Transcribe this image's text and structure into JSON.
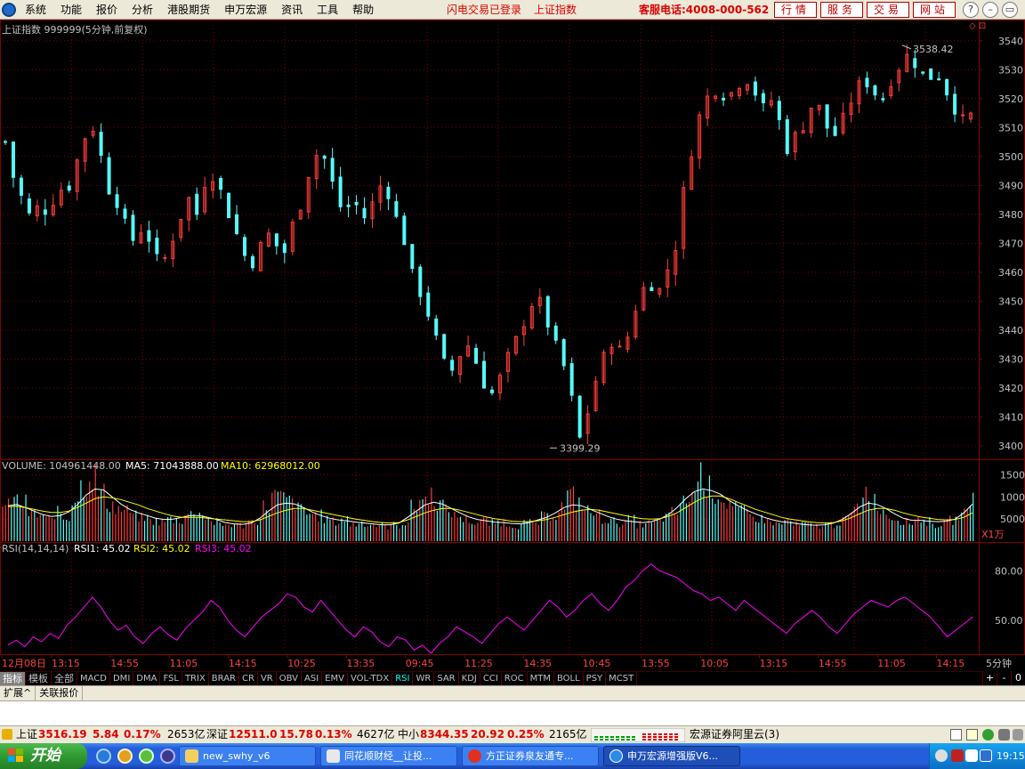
{
  "menubar": {
    "items": [
      "系统",
      "功能",
      "报价",
      "分析",
      "港股期货",
      "申万宏源",
      "资讯",
      "工具",
      "帮助"
    ],
    "status_login": "闪电交易已登录",
    "status_index": "上证指数",
    "hotline": "客服电话:4008-000-562",
    "links": [
      "行情",
      "服务",
      "交易",
      "网站"
    ],
    "window_buttons": [
      "?",
      "–",
      "▭",
      "✕"
    ]
  },
  "chart_header": {
    "title": "上证指数 999999(5分钟,前复权)"
  },
  "volume_header": {
    "volume": "VOLUME: 104961448.00",
    "ma5": "MA5: 71043888.00",
    "ma10": "MA10: 62968012.00",
    "unit": "X1万"
  },
  "rsi_header": {
    "label": "RSI(14,14,14)",
    "rsi1": "RSI1: 45.02",
    "rsi2": "RSI2: 45.02",
    "rsi3": "RSI3: 45.02"
  },
  "chart_data": [
    {
      "type": "candlestick",
      "title": "上证指数 999999(5分钟,前复权)",
      "ylim": [
        3396,
        3543
      ],
      "y_ticks": [
        3400,
        3410,
        3420,
        3430,
        3440,
        3450,
        3460,
        3470,
        3480,
        3490,
        3500,
        3510,
        3520,
        3530,
        3540
      ],
      "annotations": [
        {
          "label": "3538.42",
          "value": 3538.42,
          "type": "high"
        },
        {
          "label": "3399.29",
          "value": 3399.29,
          "type": "low"
        }
      ],
      "close_path": [
        3505,
        3492,
        3485,
        3478,
        3484,
        3480,
        3490,
        3487,
        3496,
        3506,
        3511,
        3500,
        3488,
        3484,
        3474,
        3470,
        3478,
        3466,
        3462,
        3470,
        3478,
        3486,
        3480,
        3492,
        3494,
        3486,
        3478,
        3470,
        3462,
        3466,
        3474,
        3470,
        3466,
        3476,
        3484,
        3496,
        3502,
        3498,
        3486,
        3480,
        3486,
        3478,
        3482,
        3490,
        3488,
        3478,
        3470,
        3456,
        3452,
        3442,
        3432,
        3424,
        3430,
        3436,
        3430,
        3422,
        3418,
        3424,
        3432,
        3438,
        3446,
        3452,
        3446,
        3436,
        3430,
        3418,
        3402,
        3412,
        3424,
        3432,
        3438,
        3430,
        3444,
        3452,
        3458,
        3452,
        3460,
        3468,
        3488,
        3504,
        3516,
        3522,
        3524,
        3520,
        3524,
        3528,
        3524,
        3516,
        3520,
        3512,
        3502,
        3508,
        3512,
        3520,
        3514,
        3506,
        3510,
        3518,
        3524,
        3526,
        3522,
        3520,
        3528,
        3532,
        3536,
        3530,
        3526,
        3530,
        3524,
        3518,
        3512,
        3514
      ],
      "bar_count": 122
    },
    {
      "type": "bar",
      "title": "VOLUME",
      "ylim": [
        0,
        16500
      ],
      "y_ticks": [
        5000,
        10000,
        15000
      ],
      "series": [
        {
          "name": "VOLUME",
          "values": [
            7800,
            9200,
            8600,
            6200,
            5800,
            4800,
            6400,
            5200,
            9800,
            12600,
            14800,
            10800,
            8400,
            7200,
            6800,
            5600,
            5200,
            4600,
            4400,
            5000,
            4800,
            6000,
            6800,
            5600,
            4200,
            3600,
            3800,
            3600,
            4400,
            4800,
            7800,
            10200,
            9600,
            8800,
            7200,
            6200,
            5800,
            5000,
            4400,
            5000,
            3800,
            4200,
            3800,
            3600,
            3400,
            3600,
            4200,
            7600,
            9400,
            10400,
            8400,
            6800,
            5600,
            5000,
            4200,
            4600,
            4000,
            4400,
            3800,
            3600,
            4000,
            4200,
            5400,
            6000,
            7800,
            10200,
            8800,
            6800,
            6000,
            5000,
            4400,
            4200,
            4800,
            3800,
            4000,
            4400,
            5400,
            6400,
            8600,
            10600,
            15200,
            12000,
            10400,
            8600,
            7200,
            6600,
            5600,
            5000,
            4400,
            3800,
            4600,
            3600,
            3800,
            3400,
            3600,
            3800,
            4400,
            5400,
            7600,
            11200,
            9000,
            6800,
            5600,
            4800,
            4200,
            5200,
            4400,
            3800,
            4000,
            4800,
            6000,
            9600
          ]
        },
        {
          "name": "MA5",
          "values": [
            8000,
            8300,
            7600,
            6800,
            6000,
            5600,
            5800,
            6600,
            8200,
            10400,
            11800,
            11600,
            10000,
            8400,
            7200,
            6400,
            5800,
            5200,
            4900,
            5000,
            5400,
            5800,
            5800,
            5400,
            4900,
            4200,
            3900,
            3800,
            4100,
            5200,
            6800,
            8200,
            8600,
            8400,
            7600,
            6600,
            5800,
            5200,
            4800,
            4600,
            4300,
            4100,
            3900,
            3700,
            3700,
            4100,
            5400,
            6800,
            8200,
            8800,
            8400,
            7400,
            6400,
            5500,
            4900,
            4600,
            4300,
            4200,
            4000,
            3900,
            4200,
            4800,
            5400,
            6400,
            7600,
            8200,
            8000,
            7200,
            6400,
            5600,
            5000,
            4600,
            4400,
            4200,
            4400,
            5000,
            6000,
            7600,
            9600,
            11200,
            11800,
            11400,
            10600,
            9200,
            8000,
            7000,
            6200,
            5400,
            4800,
            4400,
            4200,
            3900,
            3700,
            3600,
            3700,
            4100,
            4900,
            6200,
            7700,
            8600,
            8300,
            7400,
            6200,
            5200,
            4700,
            4700,
            4500,
            4400,
            4500,
            5000,
            6400,
            8400
          ]
        },
        {
          "name": "MA10",
          "values": [
            7800,
            7900,
            7600,
            7200,
            6800,
            6500,
            6500,
            6800,
            7600,
            8600,
            9600,
            10000,
            9800,
            9400,
            8800,
            8200,
            7400,
            6800,
            6200,
            5700,
            5400,
            5400,
            5400,
            5200,
            5000,
            4800,
            4600,
            4400,
            4400,
            4800,
            5600,
            6400,
            7000,
            7400,
            7400,
            7000,
            6600,
            6200,
            5800,
            5400,
            5000,
            4700,
            4400,
            4200,
            4100,
            4200,
            4800,
            5600,
            6400,
            7000,
            7400,
            7400,
            7000,
            6500,
            6000,
            5500,
            5100,
            4800,
            4500,
            4400,
            4400,
            4600,
            4900,
            5400,
            6000,
            6600,
            7000,
            7200,
            7000,
            6600,
            6200,
            5800,
            5400,
            5100,
            5000,
            5100,
            5600,
            6400,
            7600,
            8800,
            9800,
            10200,
            10200,
            9600,
            8800,
            8000,
            7200,
            6600,
            6000,
            5400,
            5000,
            4700,
            4400,
            4200,
            4100,
            4200,
            4600,
            5300,
            6200,
            7000,
            7400,
            7400,
            7000,
            6400,
            5900,
            5500,
            5200,
            4900,
            4800,
            4900,
            5400,
            6400
          ]
        }
      ]
    },
    {
      "type": "line",
      "title": "RSI(14,14,14)",
      "ylim": [
        30,
        92
      ],
      "y_ticks": [
        50,
        80
      ],
      "series": [
        {
          "name": "RSI3",
          "values": [
            35,
            38,
            34,
            40,
            37,
            42,
            39,
            47,
            52,
            58,
            64,
            58,
            50,
            44,
            47,
            40,
            36,
            42,
            46,
            41,
            38,
            45,
            50,
            55,
            62,
            58,
            50,
            44,
            40,
            46,
            52,
            56,
            60,
            66,
            64,
            58,
            55,
            62,
            56,
            50,
            44,
            40,
            46,
            43,
            37,
            34,
            40,
            38,
            32,
            35,
            30,
            36,
            40,
            46,
            43,
            40,
            36,
            42,
            48,
            52,
            48,
            44,
            50,
            56,
            62,
            58,
            52,
            56,
            62,
            66,
            60,
            56,
            62,
            70,
            74,
            80,
            84,
            80,
            78,
            76,
            72,
            68,
            66,
            62,
            64,
            60,
            56,
            62,
            58,
            54,
            50,
            46,
            42,
            48,
            52,
            56,
            52,
            46,
            42,
            48,
            54,
            58,
            62,
            60,
            58,
            62,
            64,
            60,
            56,
            52,
            46,
            40,
            44,
            48,
            52
          ]
        }
      ]
    }
  ],
  "x_axis": {
    "labels": [
      "12月08日",
      "13:15",
      "14:55",
      "11:05",
      "14:15",
      "10:25",
      "13:35",
      "09:45",
      "11:25",
      "14:35",
      "10:45",
      "13:55",
      "10:05",
      "13:15",
      "14:55",
      "11:05",
      "14:15"
    ],
    "period": "5分钟"
  },
  "tabs": [
    "指标",
    "模板",
    "全部",
    "MACD",
    "DMI",
    "DMA",
    "FSL",
    "TRIX",
    "BRAR",
    "CR",
    "VR",
    "OBV",
    "ASI",
    "EMV",
    "VOL-TDX",
    "RSI",
    "WR",
    "SAR",
    "KDJ",
    "CCI",
    "ROC",
    "MTM",
    "BOLL",
    "PSY",
    "MCST"
  ],
  "active_tab": "RSI",
  "tab_controls": [
    "+",
    "-",
    "0"
  ],
  "subtabs": [
    "扩展^",
    "关联报价"
  ],
  "ticker": {
    "sh_label": "上证",
    "sh_value": "3516.19",
    "sh_change": "5.84",
    "sh_pct": "0.17%",
    "sh_amount": "2653亿",
    "sz_label": "深证",
    "sz_value": "12511.0",
    "sz_change": "15.78",
    "sz_pct": "0.13%",
    "sz_amount": "4627亿",
    "zx_label": "中小",
    "zx_value": "8344.35",
    "zx_change": "20.92",
    "zx_pct": "0.25%",
    "zx_amount": "2165亿",
    "server": "宏源证券阿里云(3)"
  },
  "taskbar": {
    "start_label": "开始",
    "tasks": [
      "new_swhy_v6",
      "同花顺财经__让投...",
      "方正证券泉友通专...",
      "申万宏源增强版V6..."
    ],
    "clock": "19:15"
  },
  "colors": {
    "up": "#ff3c3c",
    "down": "#54fcfc",
    "ma5": "#ffffff",
    "ma10": "#ffff00",
    "rsi": "#ff00ff",
    "grid": "#800000",
    "axis_text": "#c0c0c0"
  }
}
